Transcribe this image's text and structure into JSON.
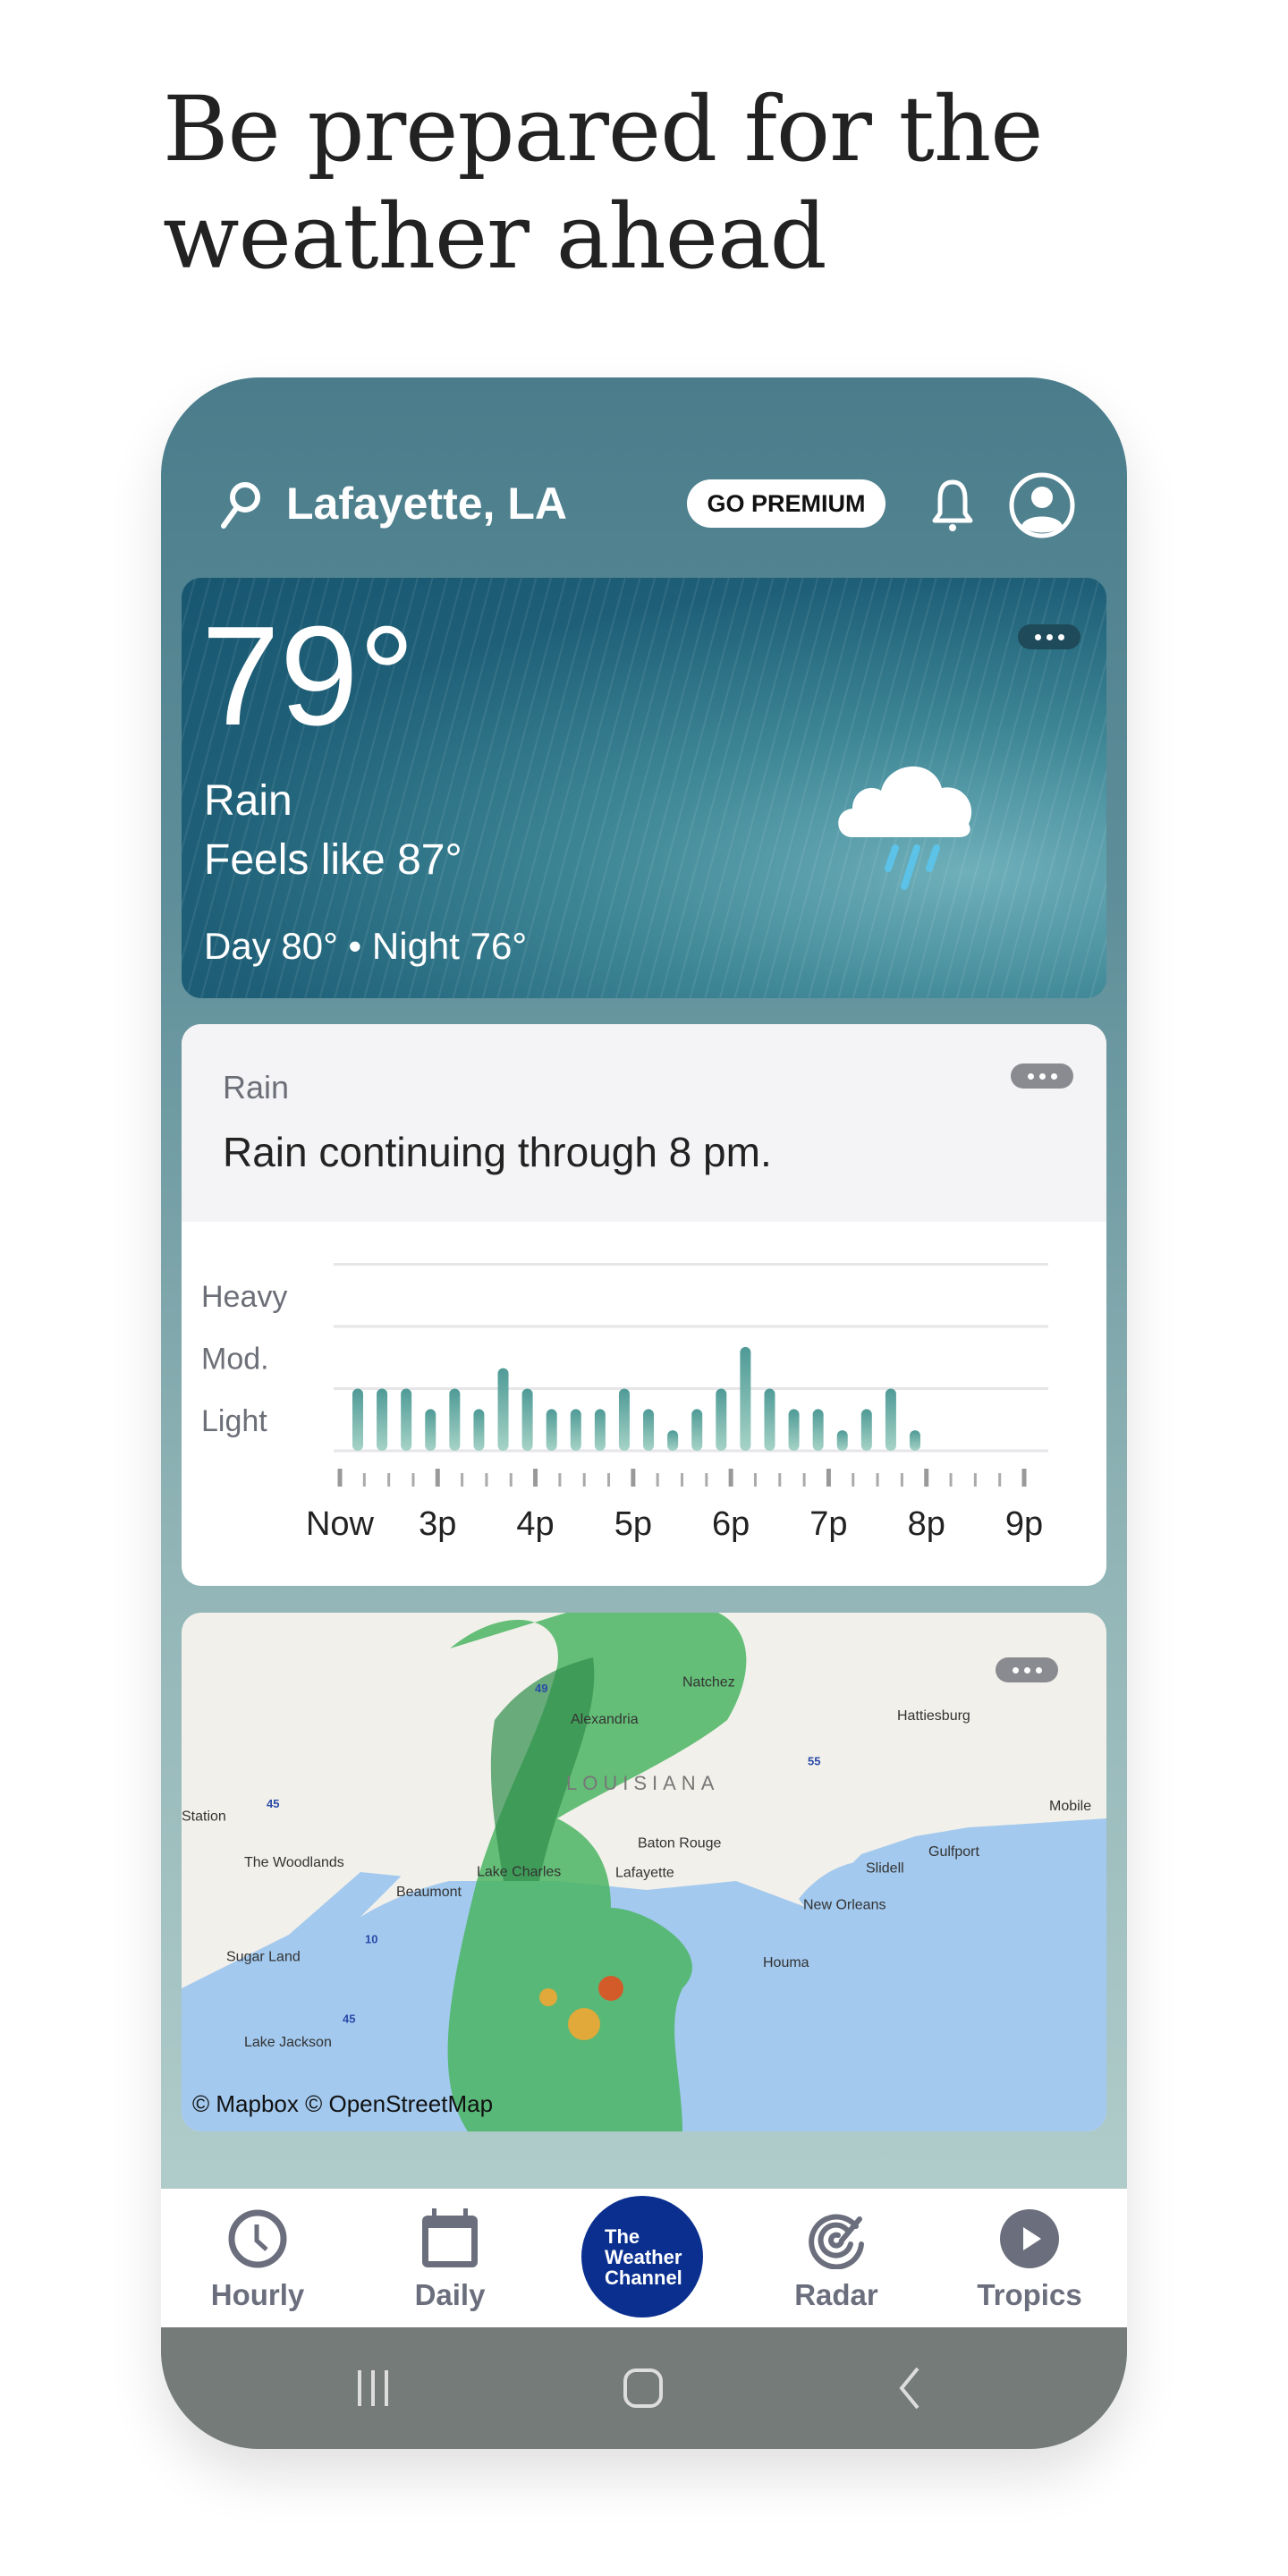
{
  "headline": [
    "Be prepared for the",
    "weather ahead"
  ],
  "header": {
    "location": "Lafayette, LA",
    "premium_label": "GO PREMIUM",
    "icons": [
      "search-icon",
      "bell-icon",
      "account-icon"
    ]
  },
  "current": {
    "temperature": "79°",
    "condition": "Rain",
    "feels_like": "Feels like 87°",
    "day_night": "Day 80° • Night 76°",
    "icon": "rain-cloud-icon"
  },
  "rain_card": {
    "label": "Rain",
    "headline": "Rain continuing through 8 pm.",
    "chart_data": {
      "type": "bar",
      "y_levels": [
        "Light",
        "Mod.",
        "Heavy"
      ],
      "ylim": [
        0,
        3
      ],
      "x_tick_labels": [
        "Now",
        "3p",
        "4p",
        "5p",
        "6p",
        "7p",
        "8p",
        "9p"
      ],
      "values": [
        1.0,
        1.0,
        1.0,
        0.67,
        1.0,
        0.67,
        1.33,
        1.0,
        0.67,
        0.67,
        0.67,
        1.0,
        0.67,
        0.33,
        0.67,
        1.0,
        1.67,
        1.0,
        0.67,
        0.67,
        0.33,
        0.67,
        1.0,
        0.33
      ],
      "bar_color": "#4f9a97",
      "grid": true
    }
  },
  "map": {
    "labels": [
      "Natchez",
      "Alexandria",
      "Hattiesburg",
      "LOUISIANA",
      "Mobile",
      "Station",
      "The Woodlands",
      "Baton Rouge",
      "Lafayette",
      "Gulfport",
      "Slidell",
      "Lake Charles",
      "Beaumont",
      "New Orleans",
      "Sugar Land",
      "Houma",
      "Lake Jackson"
    ],
    "interstates": [
      "49",
      "55",
      "45",
      "10",
      "45"
    ],
    "attribution": "© Mapbox  © OpenStreetMap"
  },
  "nav": {
    "items": [
      {
        "label": "Hourly",
        "icon": "clock-icon"
      },
      {
        "label": "Daily",
        "icon": "calendar-icon"
      },
      {
        "label": "The Weather Channel",
        "icon": "twc-logo"
      },
      {
        "label": "Radar",
        "icon": "radar-icon"
      },
      {
        "label": "Tropics",
        "icon": "play-circle-icon"
      }
    ],
    "logo_lines": [
      "The",
      "Weather",
      "Channel"
    ],
    "logo_color": "#0a2f8f"
  },
  "system_nav": [
    "recents-icon",
    "home-icon",
    "back-icon"
  ]
}
